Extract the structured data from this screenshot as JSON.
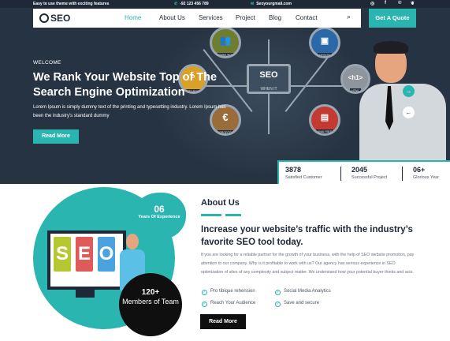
{
  "topbar": {
    "tagline": "Easy to use theme with exciting features",
    "phone": "-92 123 456 789",
    "email": "Seoyourgmail.com",
    "social": [
      "instagram-icon",
      "facebook-icon",
      "pinterest-icon",
      "twitter-icon"
    ]
  },
  "nav": {
    "logo": "SEO",
    "items": [
      "Home",
      "About Us",
      "Services",
      "Project",
      "Blog",
      "Contact"
    ],
    "active": "Home",
    "quote_button": "Get A Quote"
  },
  "hero": {
    "welcome": "WELCOME",
    "title": "We Rank Your Website Top of The Search Engine Optimization",
    "description": "Lorem Ipsum is simply dummy text of the printing and typesetting industry. Lorem Ipsum has been the industry's standard dummy",
    "read_more": "Read More",
    "diagram": {
      "center_title": "SEO",
      "center_subtitle": "WHEN IT",
      "nodes": [
        "COMMUNITY",
        "DESIGN",
        "SEARCH",
        "HTML",
        "PROFITS",
        "ANALYSES"
      ],
      "html_tag": "<h1>",
      "profits_symbol": "€"
    }
  },
  "stats": [
    {
      "number": "3878",
      "label": "Satisfied Customer"
    },
    {
      "number": "2045",
      "label": "Successful Project"
    },
    {
      "number": "06+",
      "label": "Glorious Year"
    }
  ],
  "about": {
    "experience_number": "06",
    "experience_label": "Years Of Experience",
    "members_number": "120+",
    "members_label": "Members of Team",
    "board_text": "SEO",
    "title": "About Us",
    "heading": "Increase your website’s traffic with the industry’s favorite SEO tool today.",
    "description": "If you are looking for a reliable partner for the growth of your business, with the help of SEO website promotion, pay attention to our company. Why is it profitable to work with us? Our agency has serious experience in SEO optimization of sites of any complexity and subject matter. We understand how your potential buyer thinks and acts.",
    "checks": [
      "Pro tibique rehension",
      "Social Media Analytics",
      "Reach Your Audience",
      "Save and secure"
    ],
    "button": "Read More"
  },
  "colors": {
    "accent": "#2bb5b0",
    "dark": "#1e2836",
    "hero_bg": "#263342"
  }
}
